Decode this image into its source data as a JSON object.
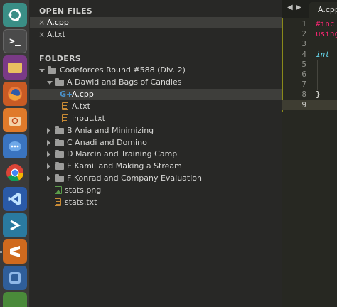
{
  "launcher": {
    "items": [
      {
        "name": "ubuntu-dash-icon",
        "color": "#3a8e86"
      },
      {
        "name": "terminal-icon",
        "color": "#3d3d3d"
      },
      {
        "name": "files-icon",
        "color": "#7a3a86"
      },
      {
        "name": "firefox-icon",
        "color": "#c95b24"
      },
      {
        "name": "software-center-icon",
        "color": "#d66a2a"
      },
      {
        "name": "chat-icon",
        "color": "#3a74c0"
      },
      {
        "name": "chrome-icon",
        "color": "#3d8a4a"
      },
      {
        "name": "vscode-icon",
        "color": "#2a5aa8"
      },
      {
        "name": "app-arrow-icon",
        "color": "#2a7aa0"
      },
      {
        "name": "sublime-text-icon",
        "color": "#d06a1e"
      },
      {
        "name": "screenshot-icon",
        "color": "#2f5e9a"
      }
    ]
  },
  "sidebar": {
    "open_files_title": "OPEN FILES",
    "open_files": [
      {
        "label": "A.cpp",
        "selected": true
      },
      {
        "label": "A.txt",
        "selected": false
      }
    ],
    "folders_title": "FOLDERS",
    "root_folder": "Codeforces Round #588 (Div. 2)",
    "folder_a": "A Dawid and Bags of Candies",
    "folder_a_files": [
      "A.cpp",
      "A.txt",
      "input.txt"
    ],
    "other_folders": [
      "B Ania and Minimizing",
      "C Anadi and Domino",
      "D Marcin and Training Camp",
      "E Kamil and Making a Stream",
      "F Konrad and Company Evaluation"
    ],
    "root_files": [
      "stats.png",
      "stats.txt"
    ]
  },
  "editor": {
    "tab_label": "A.cpp",
    "nav_left": "◀",
    "nav_right": "▶",
    "line_numbers": [
      "1",
      "2",
      "3",
      "4",
      "5",
      "6",
      "7",
      "8",
      "9"
    ],
    "code_lines": [
      {
        "text": "#inc",
        "color": "#f92672"
      },
      {
        "text": "using",
        "color": "#f92672"
      },
      {
        "text": "",
        "color": "#f8f8f2"
      },
      {
        "text": "int",
        "color": "#66d9ef"
      },
      {
        "text": "",
        "color": "#f8f8f2"
      },
      {
        "text": "",
        "color": "#f8f8f2"
      },
      {
        "text": "",
        "color": "#f8f8f2"
      },
      {
        "text": "}",
        "color": "#f8f8f2"
      },
      {
        "text": "",
        "color": "#f8f8f2"
      }
    ]
  }
}
